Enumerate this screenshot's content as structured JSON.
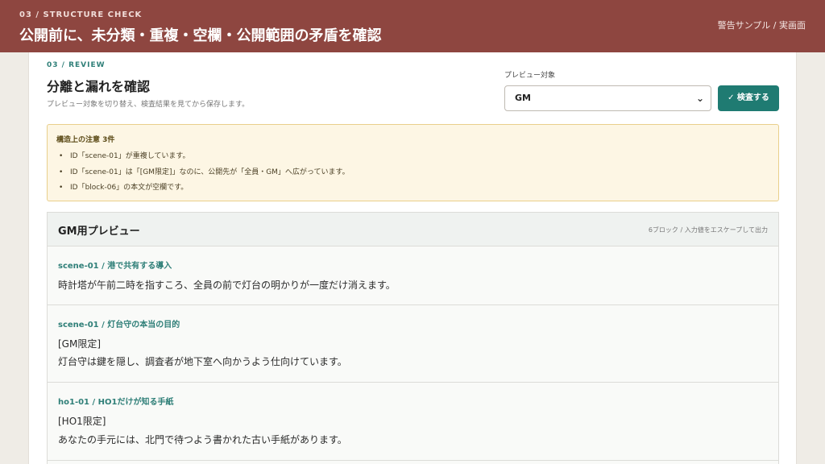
{
  "header": {
    "eyebrow": "03 / STRUCTURE CHECK",
    "title": "公開前に、未分類・重複・空欄・公開範囲の矛盾を確認",
    "right_text": "警告サンプル / 実画面"
  },
  "review": {
    "eyebrow": "03 / REVIEW",
    "title": "分離と漏れを確認",
    "subtitle": "プレビュー対象を切り替え、検査結果を見てから保存します。",
    "select_label": "プレビュー対象",
    "select_value": "GM",
    "check_button": "✓ 検査する"
  },
  "notice": {
    "title": "構造上の注意 3件",
    "items": [
      "ID「scene-01」が重複しています。",
      "ID「scene-01」は「[GM限定]」なのに、公開先が「全員・GM」へ広がっています。",
      "ID「block-06」の本文が空欄です。"
    ]
  },
  "preview": {
    "title": "GM用プレビュー",
    "meta": "6ブロック / 入力値をエスケープして出力",
    "blocks": [
      {
        "heading": "scene-01 / 港で共有する導入",
        "lines": [
          "時計塔が午前二時を指すころ、全員の前で灯台の明かりが一度だけ消えます。"
        ]
      },
      {
        "heading": "scene-01 / 灯台守の本当の目的",
        "lines": [
          "[GM限定]",
          "灯台守は鍵を隠し、調査者が地下室へ向かうよう仕向けています。"
        ]
      },
      {
        "heading": "ho1-01 / HO1だけが知る手紙",
        "lines": [
          "[HO1限定]",
          "あなたの手元には、北門で待つよう書かれた古い手紙があります。"
        ]
      }
    ]
  },
  "colors": {
    "header_bg": "#8e4640",
    "accent": "#1f7b72",
    "notice_bg": "#fdf6e4",
    "notice_border": "#e9cf8b"
  }
}
